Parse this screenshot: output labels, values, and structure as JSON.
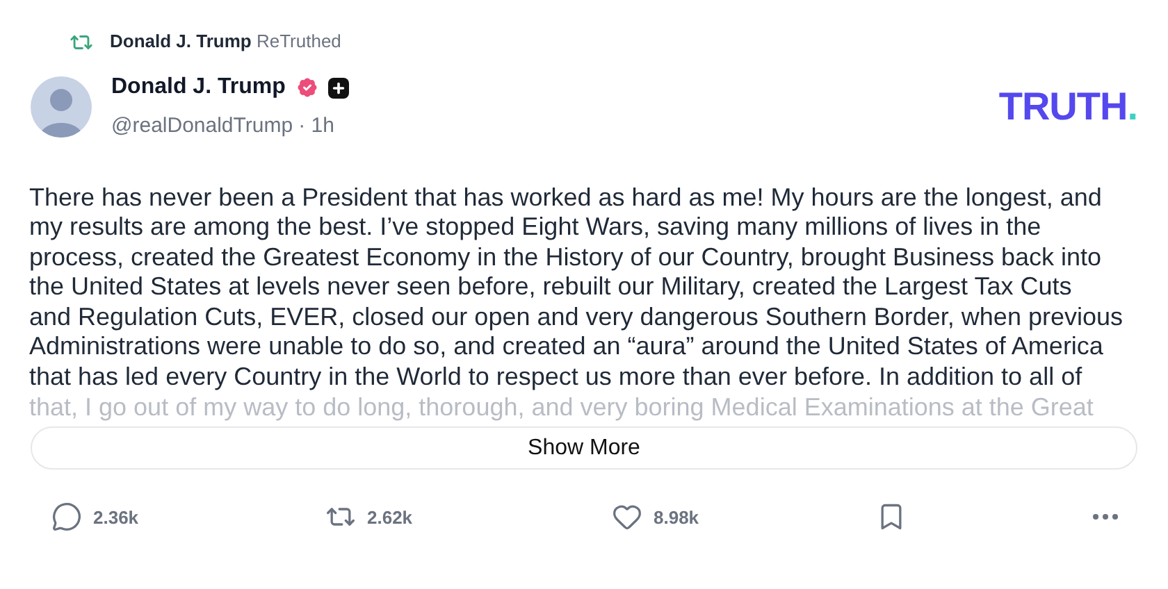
{
  "retruth": {
    "name": "Donald J. Trump",
    "label": "ReTruthed"
  },
  "author": {
    "name": "Donald J. Trump",
    "handle": "@realDonaldTrump",
    "time": "· 1h",
    "verified": true
  },
  "logo": {
    "text": "TRUTH",
    "dot": "."
  },
  "body_lines": [
    "There has never been a President that has worked as hard as me! My hours are the longest, and",
    "my results are among the best. I’ve stopped Eight Wars, saving many millions of lives in the",
    "process, created the Greatest Economy in the History of our Country, brought Business back into",
    "the United States at levels never seen before, rebuilt our Military, created the Largest Tax Cuts",
    "and Regulation Cuts, EVER, closed our open and very dangerous Southern Border, when previous",
    "Administrations were unable to do so, and created an “aura” around the United States of America",
    "that has led every Country in the World to respect us more than ever before. In addition to all of",
    "that, I go out of my way to do long, thorough, and very boring Medical Examinations at the Great"
  ],
  "show_more": "Show More",
  "actions": [
    {
      "kind": "reply",
      "count": "2.36k"
    },
    {
      "kind": "retruth",
      "count": "2.62k"
    },
    {
      "kind": "like",
      "count": "8.98k"
    },
    {
      "kind": "bookmark"
    },
    {
      "kind": "more"
    }
  ]
}
